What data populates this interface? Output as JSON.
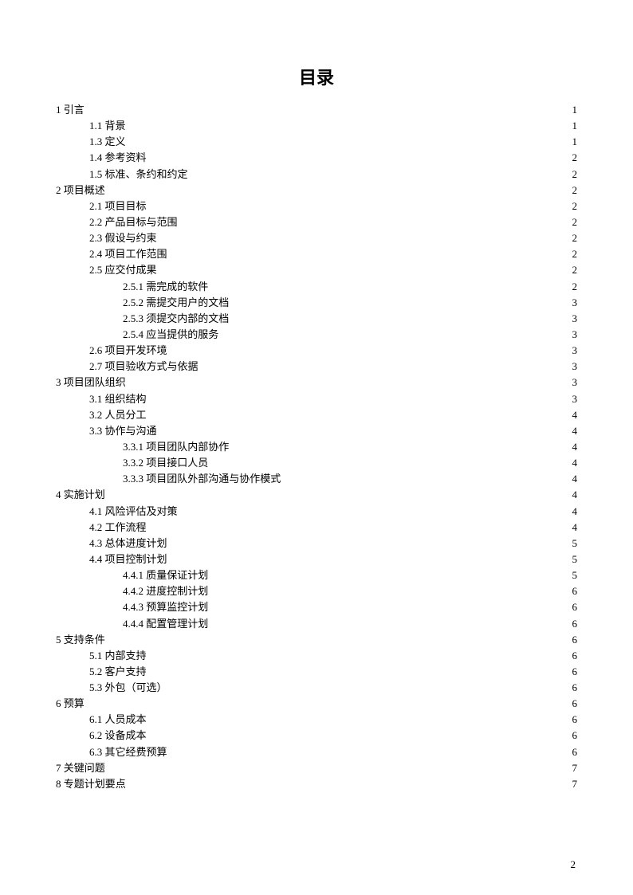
{
  "title": "目录",
  "footer_page": "2",
  "toc": [
    {
      "level": 0,
      "label": "1 引言",
      "page": "1"
    },
    {
      "level": 1,
      "label": "1.1 背景",
      "page": "1"
    },
    {
      "level": 1,
      "label": "1.3 定义",
      "page": "1"
    },
    {
      "level": 1,
      "label": "1.4 参考资料",
      "page": "2"
    },
    {
      "level": 1,
      "label": "1.5 标准、条约和约定",
      "page": "2"
    },
    {
      "level": 0,
      "label": "2 项目概述",
      "page": "2"
    },
    {
      "level": 1,
      "label": "2.1 项目目标",
      "page": "2"
    },
    {
      "level": 1,
      "label": "2.2 产品目标与范围",
      "page": "2"
    },
    {
      "level": 1,
      "label": "2.3 假设与约束",
      "page": "2"
    },
    {
      "level": 1,
      "label": "2.4 项目工作范围",
      "page": "2"
    },
    {
      "level": 1,
      "label": "2.5 应交付成果",
      "page": "2"
    },
    {
      "level": 2,
      "label": "2.5.1 需完成的软件",
      "page": "2"
    },
    {
      "level": 2,
      "label": "2.5.2 需提交用户的文档",
      "page": "3"
    },
    {
      "level": 2,
      "label": "2.5.3 须提交内部的文档",
      "page": "3"
    },
    {
      "level": 2,
      "label": "2.5.4 应当提供的服务",
      "page": "3"
    },
    {
      "level": 1,
      "label": "2.6 项目开发环境",
      "page": "3"
    },
    {
      "level": 1,
      "label": "2.7 项目验收方式与依据",
      "page": "3"
    },
    {
      "level": 0,
      "label": "3 项目团队组织",
      "page": "3"
    },
    {
      "level": 1,
      "label": "3.1 组织结构",
      "page": "3"
    },
    {
      "level": 1,
      "label": "3.2 人员分工",
      "page": "4"
    },
    {
      "level": 1,
      "label": "3.3 协作与沟通",
      "page": "4"
    },
    {
      "level": 2,
      "label": "3.3.1 项目团队内部协作",
      "page": "4"
    },
    {
      "level": 2,
      "label": "3.3.2 项目接口人员",
      "page": "4"
    },
    {
      "level": 2,
      "label": "3.3.3 项目团队外部沟通与协作模式",
      "page": "4"
    },
    {
      "level": 0,
      "label": "4 实施计划",
      "page": "4"
    },
    {
      "level": 1,
      "label": "4.1 风险评估及对策",
      "page": "4"
    },
    {
      "level": 1,
      "label": "4.2 工作流程",
      "page": "4"
    },
    {
      "level": 1,
      "label": "4.3 总体进度计划",
      "page": "5"
    },
    {
      "level": 1,
      "label": "4.4 项目控制计划",
      "page": "5"
    },
    {
      "level": 2,
      "label": "4.4.1 质量保证计划",
      "page": "5"
    },
    {
      "level": 2,
      "label": "4.4.2 进度控制计划",
      "page": "6"
    },
    {
      "level": 2,
      "label": "4.4.3 预算监控计划",
      "page": "6"
    },
    {
      "level": 2,
      "label": "4.4.4 配置管理计划",
      "page": "6"
    },
    {
      "level": 0,
      "label": "5 支持条件",
      "page": "6"
    },
    {
      "level": 1,
      "label": "5.1 内部支持",
      "page": "6"
    },
    {
      "level": 1,
      "label": "5.2 客户支持",
      "page": "6"
    },
    {
      "level": 1,
      "label": "5.3 外包（可选）",
      "page": "6"
    },
    {
      "level": 0,
      "label": "6 预算",
      "page": "6"
    },
    {
      "level": 1,
      "label": "6.1 人员成本",
      "page": "6"
    },
    {
      "level": 1,
      "label": "6.2 设备成本",
      "page": "6"
    },
    {
      "level": 1,
      "label": "6.3 其它经费预算",
      "page": "6"
    },
    {
      "level": 0,
      "label": "7 关键问题",
      "page": "7"
    },
    {
      "level": 0,
      "label": "8 专题计划要点",
      "page": "7"
    }
  ]
}
